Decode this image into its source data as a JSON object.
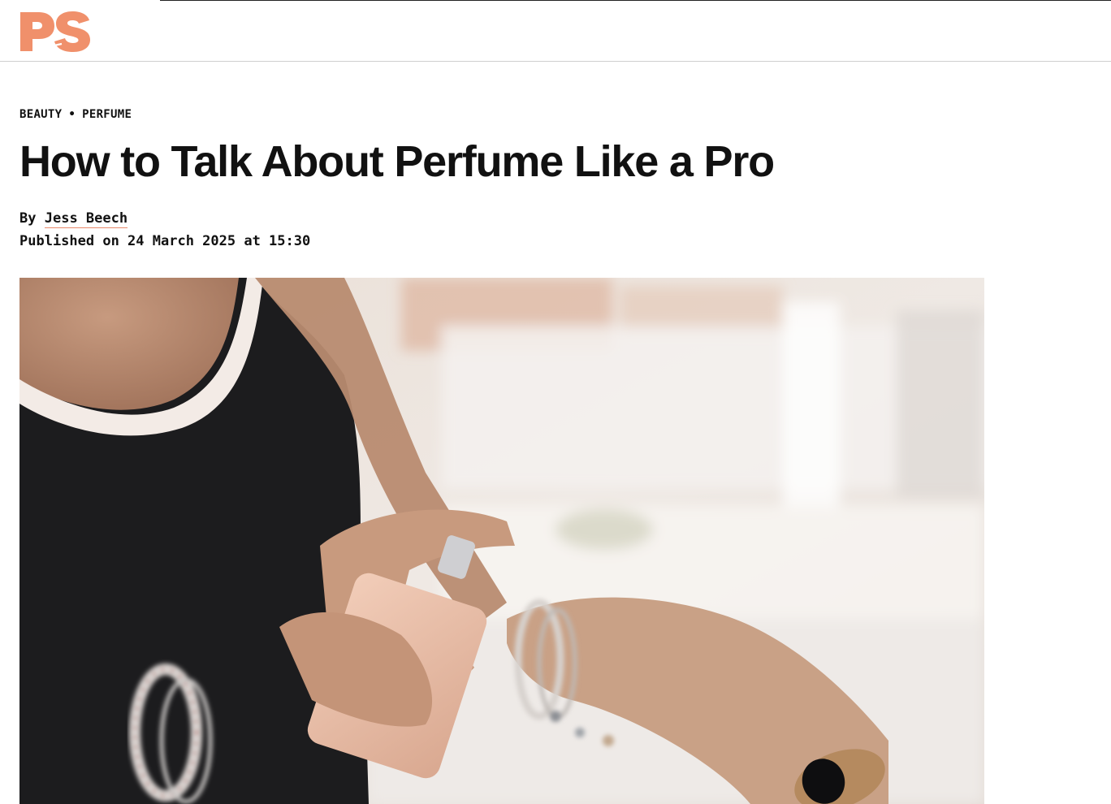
{
  "header": {
    "logo_text": "PS",
    "logo_color": "#F0906B"
  },
  "article": {
    "category": "BEAUTY",
    "subcategory": "PERFUME",
    "category_separator": "•",
    "title": "How to Talk About Perfume Like a Pro",
    "byline_prefix": "By",
    "author": "Jess Beech",
    "published": "Published on 24 March 2025 at 15:30"
  },
  "hero_image": {
    "subject": "woman spraying perfume on wrist",
    "icon": "photo"
  },
  "colors": {
    "accent": "#F0906B",
    "text": "#111111",
    "divider": "#CFCFCF"
  }
}
